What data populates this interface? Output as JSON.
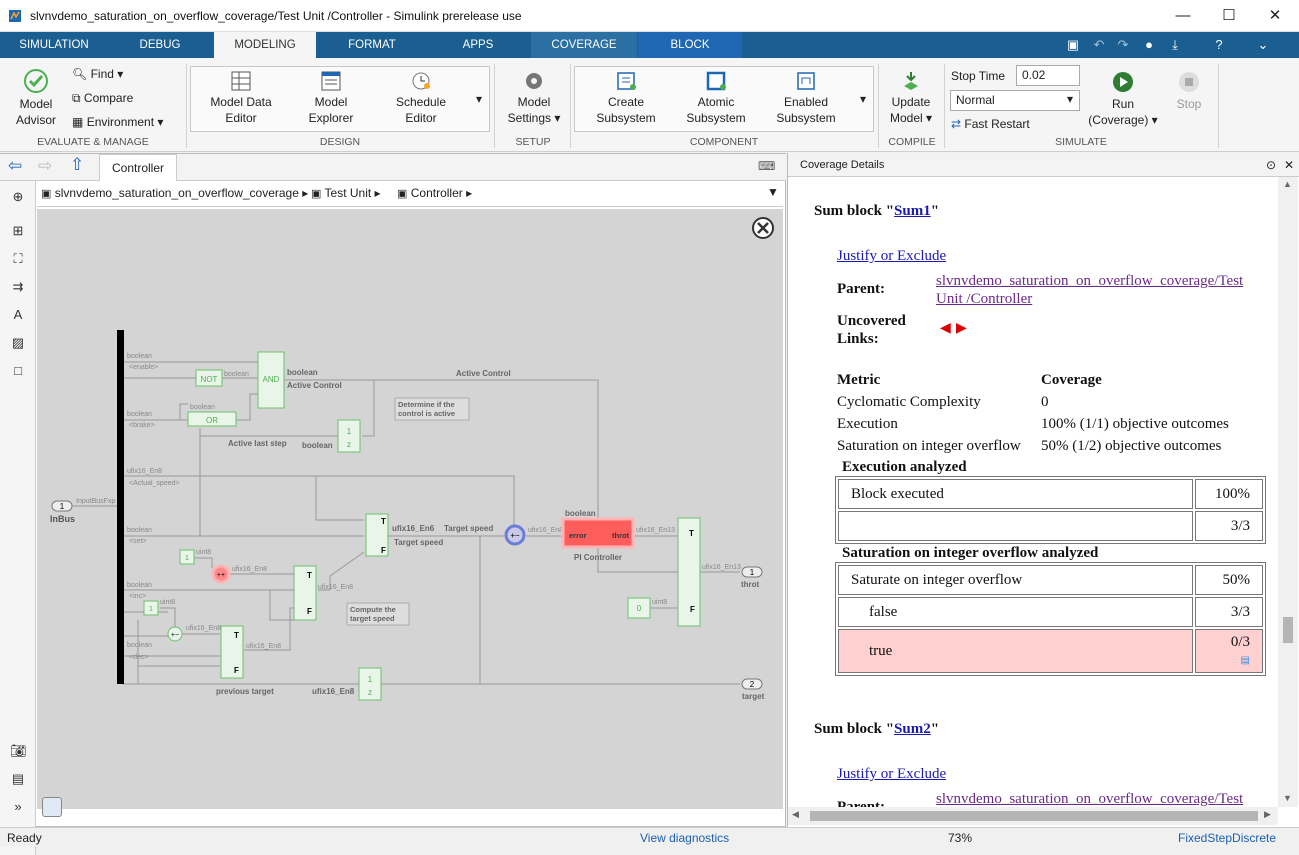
{
  "window": {
    "title": "slvnvdemo_saturation_on_overflow_coverage/Test Unit /Controller - Simulink prerelease use",
    "minimize": "—",
    "maximize": "☐",
    "close": "✕"
  },
  "tabs": [
    {
      "label": "SIMULATION"
    },
    {
      "label": "DEBUG"
    },
    {
      "label": "MODELING"
    },
    {
      "label": "FORMAT"
    },
    {
      "label": "APPS"
    },
    {
      "label": "COVERAGE"
    },
    {
      "label": "BLOCK"
    }
  ],
  "ribbon": {
    "evaluate": {
      "model_advisor": "Model\nAdvisor",
      "find": "Find",
      "compare": "Compare",
      "environment": "Environment",
      "group": "EVALUATE & MANAGE"
    },
    "design": {
      "model_data_editor": "Model Data\nEditor",
      "model_explorer": "Model\nExplorer",
      "schedule_editor": "Schedule\nEditor",
      "group": "DESIGN"
    },
    "setup": {
      "model_settings": "Model\nSettings",
      "group": "SETUP"
    },
    "component": {
      "create_subsystem": "Create\nSubsystem",
      "atomic_subsystem": "Atomic\nSubsystem",
      "enabled_subsystem": "Enabled\nSubsystem",
      "group": "COMPONENT"
    },
    "compile": {
      "update_model": "Update\nModel",
      "group": "COMPILE"
    },
    "simulate": {
      "stop_time_label": "Stop Time",
      "stop_time_value": "0.02",
      "mode": "Normal",
      "fast_restart": "Fast Restart",
      "run": "Run\n(Coverage)",
      "stop": "Stop",
      "group": "SIMULATE"
    }
  },
  "editor": {
    "tab": "Controller",
    "path": [
      "slvnvdemo_saturation_on_overflow_coverage",
      "Test Unit",
      "Controller"
    ]
  },
  "diagram": {
    "labels": {
      "boolean": "boolean",
      "enable": "<enable>",
      "brake": "<brake>",
      "not": "NOT",
      "or": "OR",
      "and": "AND",
      "active_control_block": "Active Control",
      "active_control_line": "Active Control",
      "determine": "Determine if the\ncontrol is active",
      "active_last_step": "Active last step",
      "unit_delay": "1\nz",
      "ufix16_en8": "ufix16_En8",
      "actual_speed": "<Actual_speed>",
      "inbus": "InBus",
      "inbus_num": "1",
      "input_bus": "InputBusFxp",
      "set": "<set>",
      "inc": "<inc>",
      "dec": "<dec>",
      "uint8": "uint8",
      "const1": "1",
      "const0": "0",
      "target_speed": "Target speed",
      "target_speed2": "Target speed",
      "ufix16_en6": "ufix16_En6",
      "compute": "Compute the\ntarget speed",
      "previous_target": "previous target",
      "pi_controller": "PI Controller",
      "error": "error",
      "throt": "throt",
      "ufix16_en13": "ufix16_En13",
      "out_throt": "throt",
      "out_target": "target",
      "out1": "1",
      "out2": "2",
      "switch_t": "T",
      "switch_f": "F"
    }
  },
  "coverage": {
    "panel_title": "Coverage Details",
    "block1": {
      "heading_prefix": "Sum block \"",
      "name": "Sum1",
      "heading_suffix": "\"",
      "justify": "Justify or Exclude",
      "parent_label": "Parent:",
      "parent_link": "slvnvdemo_saturation_on_overflow_coverage/Test Unit /Controller",
      "uncovered_label": "Uncovered Links:",
      "metric_header": "Metric",
      "coverage_header": "Coverage",
      "metrics": [
        {
          "metric": "Cyclomatic Complexity",
          "coverage": "0"
        },
        {
          "metric": "Execution",
          "coverage": "100% (1/1) objective outcomes"
        },
        {
          "metric": "Saturation on integer overflow",
          "coverage": "50% (1/2) objective outcomes"
        }
      ],
      "exec_title": "Execution analyzed",
      "exec_rows": [
        {
          "label": "Block executed",
          "value": "100%"
        },
        {
          "label": "",
          "value": "3/3"
        }
      ],
      "sat_title": "Saturation on integer overflow analyzed",
      "sat_rows": [
        {
          "label": "Saturate on integer overflow",
          "value": "50%"
        },
        {
          "label": "false",
          "value": "3/3"
        },
        {
          "label": "true",
          "value": "0/3"
        }
      ]
    },
    "block2": {
      "heading_prefix": "Sum block \"",
      "name": "Sum2",
      "heading_suffix": "\"",
      "justify": "Justify or Exclude",
      "parent_label": "Parent:",
      "parent_link": "slvnvdemo_saturation_on_overflow_coverage/Test"
    }
  },
  "status": {
    "left": "Ready",
    "diagnostics": "View diagnostics",
    "zoom": "73%",
    "solver": "FixedStepDiscrete"
  },
  "colors": {
    "tabbar": "#1b5e92",
    "block_green": "#4caf50",
    "uncovered_red": "#e53935",
    "table_highlight": "#ffd0d0"
  }
}
